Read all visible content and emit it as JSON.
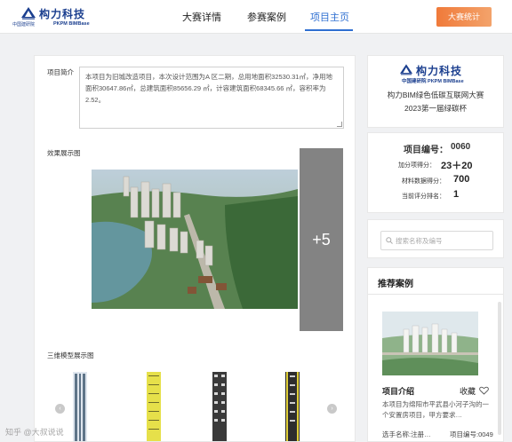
{
  "header": {
    "logo_cn": "构力科技",
    "logo_sub_left": "中国建研院",
    "logo_sub_right": "PKPM BIMBase",
    "nav": [
      "大赛详情",
      "参赛案例",
      "项目主页"
    ],
    "active_nav": "项目主页",
    "stats_button": "大赛统计",
    "accent": "#2f6fd1",
    "button_color": "#f07a3a"
  },
  "left": {
    "intro_label": "项目简介",
    "intro_text": "本项目为旧城改造项目，本次设计范围为A 区二期，总用地面积32530.31㎡，净用地面积30647.86㎡，总建筑面积85656.29 ㎡，计容建筑面积68345.66 ㎡，容积率为2.52。",
    "render_label": "效果展示图",
    "more_count": "+5",
    "model_label": "三维模型展示图",
    "prev_icon": "‹",
    "next_icon": "›"
  },
  "right": {
    "org_logo_cn": "构力科技",
    "org_logo_sub": "中国建研院 PKPM BIMBase",
    "contest_line1": "构力BIM绿色低碳互联网大赛",
    "contest_line2": "2023第一届绿碳杯",
    "project_no_label": "项目编号：",
    "project_no": "0060",
    "bonus_label": "加分项得分：",
    "bonus_value": "23＋20",
    "material_label": "材料数据得分：",
    "material_value": "700",
    "rank_label": "当前评分排名：",
    "rank_value": "1",
    "search_placeholder": "搜索名称及编号",
    "recommend_title": "推荐案例",
    "case_intro_label": "项目介绍",
    "favorite_label": "收藏",
    "case_desc": "本项目为绵阳市平武县小河子沟的一个安置房项目，甲方要求…",
    "case_team_label": "选手名称:注册…",
    "case_id_label": "项目编号:0049"
  },
  "watermark": "知乎 @大叔说说"
}
